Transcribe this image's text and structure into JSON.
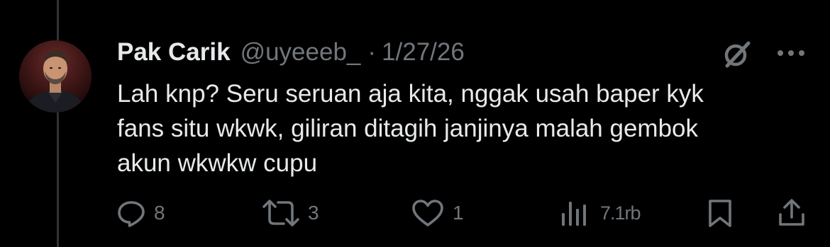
{
  "tweet": {
    "display_name": "Pak Carik",
    "handle": "@uyeeeb_",
    "separator": "·",
    "date": "1/27/26",
    "text": "Lah knp? Seru seruan aja kita, nggak usah baper kyk\nfans situ wkwk, giliran ditagih janjinya malah gembok\nakun wkwkw cupu"
  },
  "actions": {
    "replies": "8",
    "reposts": "3",
    "likes": "1",
    "views": "7.1rb"
  },
  "icons": {
    "reply": "reply-icon",
    "repost": "repost-icon",
    "like": "heart-icon",
    "views": "views-icon",
    "bookmark": "bookmark-icon",
    "share": "share-icon",
    "grok": "grok-icon",
    "more": "more-icon"
  },
  "colors": {
    "background": "#000000",
    "primary_text": "#e7e9ea",
    "secondary_text": "#71767b",
    "thread_line": "#2f3336"
  }
}
